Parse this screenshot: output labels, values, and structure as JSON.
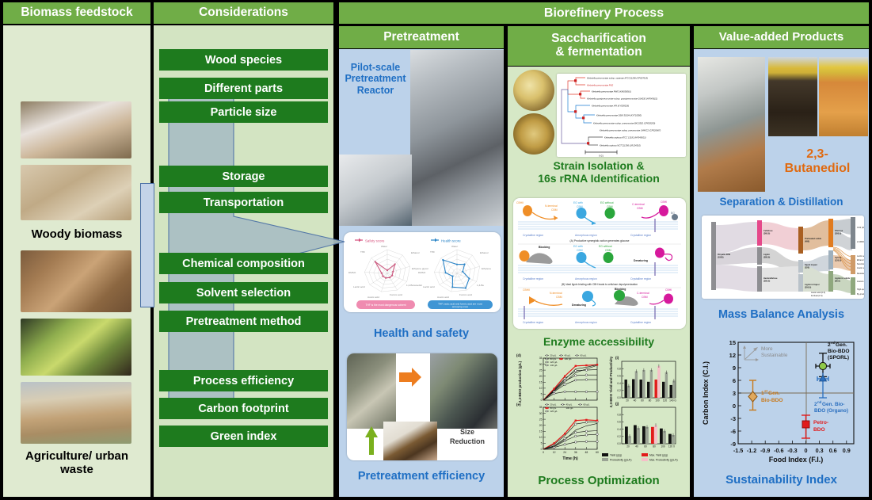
{
  "headers": {
    "feedstock": "Biomass feedstock",
    "considerations": "Considerations",
    "biorefinery": "Biorefinery Process",
    "pretreatment": "Pretreatment",
    "saccharification": "Saccharification\n& fermentation",
    "value_added": "Value-added Products"
  },
  "colors": {
    "header_green": "#70ad47",
    "dark_green": "#1e7b1e",
    "pale_green_bg": "#dfead0",
    "consider_bg": "#d3e4c2",
    "blue_panel_bg": "#bcd2ea",
    "sacc_panel_bg": "#d6e8c6",
    "caption_blue": "#1f6fc4",
    "caption_green": "#1e7b1e",
    "orange": "#e06a10",
    "arrow_fill": "#a9bfc4",
    "arrow_stroke": "#4a6fa5"
  },
  "feedstock": {
    "caption_woody": "Woody biomass",
    "caption_waste": "Agriculture/ urban waste",
    "images": [
      {
        "name": "brushwood-pile",
        "alt": "Brushwood / slash pile"
      },
      {
        "name": "white-rot-bark",
        "alt": "White rot fungus on bark"
      },
      {
        "name": "wood-shavings",
        "alt": "Wood shavings"
      },
      {
        "name": "forest-residue-sticks",
        "alt": "Forest residue sticks"
      },
      {
        "name": "vegetable-food-waste",
        "alt": "Vegetable food waste bin"
      },
      {
        "name": "agricultural-field-residue",
        "alt": "Agricultural field residue"
      }
    ]
  },
  "considerations": {
    "items": [
      "Wood species",
      "Different parts",
      "Particle size",
      "Storage",
      "Transportation",
      "Chemical composition",
      "Solvent selection",
      "Pretreatment method",
      "Process efficiency",
      "Carbon footprint",
      "Green index"
    ]
  },
  "pretreatment": {
    "reactor_label": "Pilot-scale\nPretreatment\nReactor",
    "caption_health": "Health and safety",
    "caption_efficiency": "Pretreatment efficiency",
    "size_reduction_label": "Size\nReduction",
    "radar": {
      "legend_left": "Safety score",
      "legend_right": "Health score",
      "note_left": "THF is the most dangerous solvent",
      "note_right": "THF, lactic acid and formic acid are most annoying ones",
      "axes": [
        "Water",
        "Ethanol",
        "Ethylene glycol",
        "1,4-Butanediol",
        "Formic acid",
        "Acetic acid",
        "Lactic acid",
        "DMSO",
        "THF"
      ],
      "safety_values": [
        1,
        4,
        2,
        2,
        2,
        2,
        2,
        2,
        6
      ],
      "health_values": [
        3,
        2,
        2,
        5,
        7,
        6,
        2,
        4,
        7
      ],
      "scale_max": 8
    }
  },
  "saccharification": {
    "caption_strain": "Strain Isolation &\n16s rRNA Identification",
    "caption_enzyme": "Enzyme accessibility",
    "caption_process": "Process Optimization",
    "phylogeny": {
      "scale_bar": "0.01",
      "taxa": [
        "Klebsiella pneumoniae subsp. ozaenae ATCC11296 (CP027015)",
        "Klebsiella pneumoniae FM2",
        "Klebsiella pneumoniae RWG (KM030061)",
        "Klebsiella quasipneumoniae subsp. quasipneumoniae 01A030 (HF545622)",
        "Klebsiella pneumoniae API (KY009328)",
        "Klebsiella pneumoniae DSM 30104 (KX710050)",
        "Klebsiella pneumoniae subsp. pneumoniae BK13302 (CP003200)",
        "Klebsiella pneumoniae subsp. pneumoniae JM45C2 (CP020867)",
        "Klebsiella oxytoca ATCC 13182 (HF545631)",
        "Klebsiella oxytoca NCTC11356 (LR134310)"
      ],
      "bootstrap": [
        99,
        86,
        94,
        54,
        68,
        75,
        100
      ]
    },
    "enzyme_panels": [
      {
        "caption": "(A)  Productive synergistic action generates glucose",
        "labels": [
          "CBHII",
          "N-terminal CBM",
          "EG with CBM",
          "EG without CBM",
          "C-terminal CBM",
          "CBHI",
          "BG"
        ],
        "regions": [
          "Crystalline region",
          "Amorphous region",
          "Crystalline region"
        ]
      },
      {
        "caption": "(B) Ideal lignin binding with CBH leads to cellulose depolymerization",
        "labels": [
          "Blocking",
          "EG with CBM",
          "EG without CBM",
          "Denaturing"
        ],
        "regions": [
          "Crystalline region",
          "Amorphous region",
          "Crystalline region"
        ]
      },
      {
        "caption": "(C)",
        "labels": [
          "CBHII",
          "N-terminal CBM",
          "Denaturing",
          "Blocking",
          "C-terminal CBM",
          "CBHI"
        ],
        "regions": [
          "Crystalline region",
          "Amorphous region",
          "Crystalline region"
        ]
      }
    ]
  },
  "value_added": {
    "product_label": "2,3-\nButanediol",
    "caption_separation": "Separation & Distillation",
    "caption_mass_balance": "Mass Balance Analysis",
    "caption_sustainability": "Sustainability Index",
    "sankey": {
      "nodes": [
        "Oil palm EFB (1000)",
        "Cellulose (360.0)",
        "Lignin (280.0)",
        "Hemicellulose (280.0)",
        "Pretreated solids (480)",
        "Spent liquor (520)",
        "Glucose (300.0)",
        "Xylose (120.0)",
        "Lignin in solids (80.0)",
        "Lignin in liquor (200.0)",
        "Acetic acid (0.5)",
        "Furfural (1.5)",
        "CO2 (200.0)",
        "2,3-BDO (147)",
        "Lactic acid (74.0)",
        "Ethanol (53.5)",
        "Succinic acid (9.0)",
        "Acetic acid (5)",
        "Residues (7.9)",
        "Acetoin (26.5)",
        "High-quality lignin",
        "By-products (3.6)"
      ]
    }
  },
  "chart_data": [
    {
      "type": "line",
      "id": "bdo-production-d",
      "panel_label": "(d)",
      "title": "",
      "xlabel": "Time (h)",
      "ylabel": "2,3-BDO production (g/L)",
      "xlim": [
        0,
        60
      ],
      "ylim": [
        0,
        35
      ],
      "xticks": [
        0,
        12,
        24,
        36,
        48,
        60
      ],
      "yticks": [
        0,
        5,
        10,
        15,
        20,
        25,
        30,
        35
      ],
      "legend": [
        "20 g/L",
        "40 g/L",
        "60 g/L",
        "80 g/L",
        "100 g/L",
        "120 g/L",
        "140 g/L"
      ],
      "highlight_series": "100 g/L",
      "x": [
        0,
        12,
        24,
        36,
        48,
        60
      ],
      "series": [
        {
          "name": "20 g/L",
          "values": [
            0,
            5.5,
            7.0,
            7.0,
            7.0,
            7.0
          ]
        },
        {
          "name": "40 g/L",
          "values": [
            0,
            7.0,
            13.0,
            16.5,
            17.0,
            17.0
          ]
        },
        {
          "name": "60 g/L",
          "values": [
            0,
            8.0,
            16.0,
            20.5,
            21.0,
            21.0
          ]
        },
        {
          "name": "80 g/L",
          "values": [
            0,
            9.0,
            18.0,
            24.5,
            25.0,
            25.5
          ]
        },
        {
          "name": "100 g/L",
          "values": [
            0,
            9.5,
            20.0,
            28.5,
            29.0,
            29.5
          ]
        },
        {
          "name": "120 g/L",
          "values": [
            0,
            8.5,
            17.0,
            26.0,
            27.5,
            29.5
          ]
        },
        {
          "name": "140 g/L",
          "values": [
            0,
            7.5,
            15.0,
            23.0,
            26.0,
            29.0
          ]
        }
      ]
    },
    {
      "type": "line",
      "id": "bdo-production-e",
      "panel_label": "(e)",
      "xlabel": "Time (h)",
      "ylabel": "2,3-BDO production (g/L)",
      "xlim": [
        0,
        60
      ],
      "ylim": [
        0,
        35
      ],
      "xticks": [
        0,
        12,
        24,
        36,
        48,
        60
      ],
      "yticks": [
        0,
        5,
        10,
        15,
        20,
        25,
        30,
        35
      ],
      "legend": [
        "20 g/L",
        "40 g/L",
        "60 g/L",
        "80 g/L",
        "100 g/L",
        "120 g/L"
      ],
      "highlight_series": "80 g/L",
      "x": [
        0,
        12,
        24,
        36,
        48,
        60
      ],
      "series": [
        {
          "name": "20 g/L",
          "values": [
            0,
            1.5,
            4.0,
            6.0,
            6.5,
            6.5
          ]
        },
        {
          "name": "40 g/L",
          "values": [
            0,
            2.0,
            7.0,
            11.0,
            12.0,
            12.5
          ]
        },
        {
          "name": "60 g/L",
          "values": [
            0,
            3.0,
            9.0,
            14.0,
            15.0,
            15.5
          ]
        },
        {
          "name": "80 g/L",
          "values": [
            0,
            5.0,
            13.0,
            24.0,
            24.5,
            24.0
          ]
        },
        {
          "name": "100 g/L",
          "values": [
            0,
            4.0,
            11.5,
            21.0,
            22.5,
            23.0
          ]
        },
        {
          "name": "120 g/L",
          "values": [
            0,
            2.5,
            8.0,
            16.0,
            19.5,
            21.5
          ]
        }
      ]
    },
    {
      "type": "bar",
      "id": "yield-productivity-i",
      "panel_label": "(i)",
      "ylabel": "2,3-BDO Yield and Productivity",
      "xlabel": "",
      "ylim": [
        0.0,
        1.0
      ],
      "yticks": [
        0.0,
        0.2,
        0.4,
        0.6,
        0.8
      ],
      "categories": [
        "20",
        "40",
        "60",
        "80",
        "100",
        "120",
        "140 G"
      ],
      "legend": [
        "Yield (g/g)",
        "Productivity (g/L/h)",
        "Max. Yield (g/g)",
        "Max. Productivity (g/L/h)"
      ],
      "highlight_category": "100",
      "series": [
        {
          "name": "Yield (g/g)",
          "values": [
            0.5,
            0.51,
            0.5,
            0.44,
            0.5,
            0.44,
            0.35
          ]
        },
        {
          "name": "Productivity (g/L/h)",
          "values": [
            0.33,
            0.73,
            0.76,
            0.76,
            0.87,
            0.7,
            0.47
          ]
        }
      ]
    },
    {
      "type": "bar",
      "id": "yield-productivity-j",
      "panel_label": "(j)",
      "ylabel": "2,3-BDO Yield and Productivity",
      "xlabel": "",
      "ylim": [
        0.0,
        1.0
      ],
      "yticks": [
        0.0,
        0.2,
        0.4,
        0.6,
        0.8
      ],
      "categories": [
        "20",
        "40",
        "60",
        "80",
        "100",
        "120 X"
      ],
      "legend": [
        "Yield (g/g)",
        "Productivity (g/L/h)",
        "Max. Yield (g/g)",
        "Max. Productivity (g/L/h)"
      ],
      "highlight_category": "80",
      "series": [
        {
          "name": "Yield (g/g)",
          "values": [
            0.47,
            0.51,
            0.48,
            0.46,
            0.42,
            0.27
          ]
        },
        {
          "name": "Productivity (g/L/h)",
          "values": [
            0.21,
            0.43,
            0.46,
            0.51,
            0.35,
            0.24
          ]
        }
      ]
    },
    {
      "type": "scatter",
      "id": "sustainability-index",
      "title": "",
      "xlabel": "Food Index (F.I.)",
      "ylabel": "Carbon Index (C.I.)",
      "xlim": [
        -1.5,
        1.05
      ],
      "ylim": [
        -9,
        15
      ],
      "xticks": [
        -1.5,
        -1.2,
        -0.9,
        -0.6,
        -0.3,
        0,
        0.3,
        0.6,
        0.9
      ],
      "yticks": [
        -9,
        -6,
        -3,
        0,
        3,
        6,
        9,
        12,
        15
      ],
      "annotation": "More Sustainable",
      "points": [
        {
          "label": "1st Gen. Bio-BDO",
          "x": -1.18,
          "y": 2.9,
          "yerr_low": -0.2,
          "yerr_high": 5.7,
          "marker": "diamond",
          "color": "#c8791a"
        },
        {
          "label": "2nd Gen. Bio-BDO (SPORL)",
          "x": 0.42,
          "y": 9.3,
          "yerr_low": 6.8,
          "yerr_high": 12.4,
          "xerr": 0.17,
          "marker": "circle",
          "color": "#8fc94a"
        },
        {
          "label": "2nd Gen. Bio-BDO (Organo)",
          "x": 0.42,
          "y": 6.3,
          "yerr_low": 1.9,
          "yerr_high": 7.8,
          "xerr": 0.12,
          "marker": "triangle",
          "color": "#2a6fbf"
        },
        {
          "label": "Petro-BDO",
          "x": 0.0,
          "y": -3.9,
          "yerr_low": -7.2,
          "yerr_high": -1.8,
          "marker": "square",
          "color": "#e11b1b"
        }
      ]
    },
    {
      "type": "radar",
      "id": "solvent-safety-radar",
      "title": "Safety score",
      "categories": [
        "Water",
        "Ethanol",
        "Ethylene glycol",
        "1,4-Butanediol",
        "Formic acid",
        "Acetic acid",
        "Lactic acid",
        "DMSO",
        "THF"
      ],
      "values": [
        1,
        4,
        2,
        2,
        2,
        2,
        2,
        2,
        6
      ],
      "ylim": [
        0,
        8
      ],
      "color": "#d6537f"
    },
    {
      "type": "radar",
      "id": "solvent-health-radar",
      "title": "Health score",
      "categories": [
        "Water",
        "Ethanol",
        "Ethylene glycol",
        "1,4-Butanediol",
        "Formic acid",
        "Acetic acid",
        "Lactic acid",
        "DMSO",
        "THF"
      ],
      "values": [
        3,
        2,
        2,
        5,
        7,
        6,
        2,
        4,
        7
      ],
      "ylim": [
        0,
        8
      ],
      "color": "#2e86c8"
    }
  ]
}
